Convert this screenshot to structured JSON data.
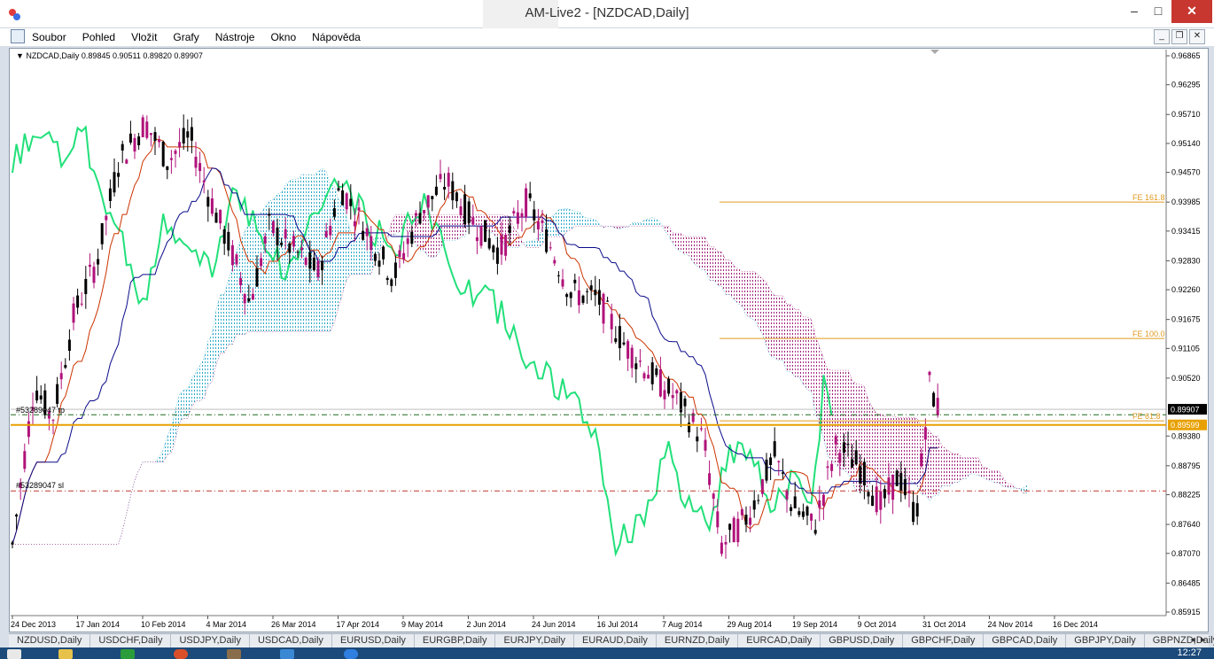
{
  "window": {
    "title": "AM-Live2 - [NZDCAD,Daily]",
    "minimize_glyph": "–",
    "maximize_glyph": "□",
    "close_glyph": "✕"
  },
  "menu": {
    "items": [
      "Soubor",
      "Pohled",
      "Vložit",
      "Grafy",
      "Nástroje",
      "Okno",
      "Nápověda"
    ],
    "mdi_minimize": "_",
    "mdi_restore": "❐",
    "mdi_close": "✕"
  },
  "chart": {
    "symbol_line": "NZDCAD,Daily  0.89845 0.90511 0.89820 0.89907",
    "price_labels": [
      "0.96865",
      "0.96295",
      "0.95710",
      "0.95140",
      "0.94570",
      "0.93985",
      "0.93415",
      "0.92830",
      "0.92260",
      "0.91675",
      "0.91105",
      "0.90520",
      "0.89380",
      "0.88795",
      "0.88225",
      "0.87640",
      "0.87070",
      "0.86485",
      "0.85915"
    ],
    "current_price": "0.89907",
    "level_price": "0.89599",
    "date_labels": [
      "24 Dec 2013",
      "17 Jan 2014",
      "10 Feb 2014",
      "4 Mar 2014",
      "26 Mar 2014",
      "17 Apr 2014",
      "9 May 2014",
      "2 Jun 2014",
      "24 Jun 2014",
      "16 Jul 2014",
      "7 Aug 2014",
      "29 Aug 2014",
      "19 Sep 2014",
      "9 Oct 2014",
      "31 Oct 2014",
      "24 Nov 2014",
      "16 Dec 2014"
    ],
    "order_tp_label": "#53289047 tp",
    "order_sl_label": "#53289047 sl",
    "fe_labels": [
      "FE 161.8",
      "FE 100.0",
      "FE 61.8"
    ],
    "colors": {
      "bull": "#000000",
      "bear": "#b0127a",
      "tenkan": "#cc3300",
      "kijun": "#0a0a8a",
      "chikou": "#22e07a",
      "cloud_bull": "#2aa8c8",
      "cloud_bear": "#a0207a",
      "fibo": "#e09a20",
      "level": "#e8a000",
      "tp": "#1c6b1c",
      "sl": "#c0392b"
    }
  },
  "tabs": [
    "NZDUSD,Daily",
    "USDCHF,Daily",
    "USDJPY,Daily",
    "USDCAD,Daily",
    "EURUSD,Daily",
    "EURGBP,Daily",
    "EURJPY,Daily",
    "EURAUD,Daily",
    "EURNZD,Daily",
    "EURCAD,Daily",
    "GBPUSD,Daily",
    "GBPCHF,Daily",
    "GBPCAD,Daily",
    "GBPJPY,Daily",
    "GBPNZD,Daily"
  ],
  "tab_arrows": "◄ ►",
  "clock": "12:27"
}
